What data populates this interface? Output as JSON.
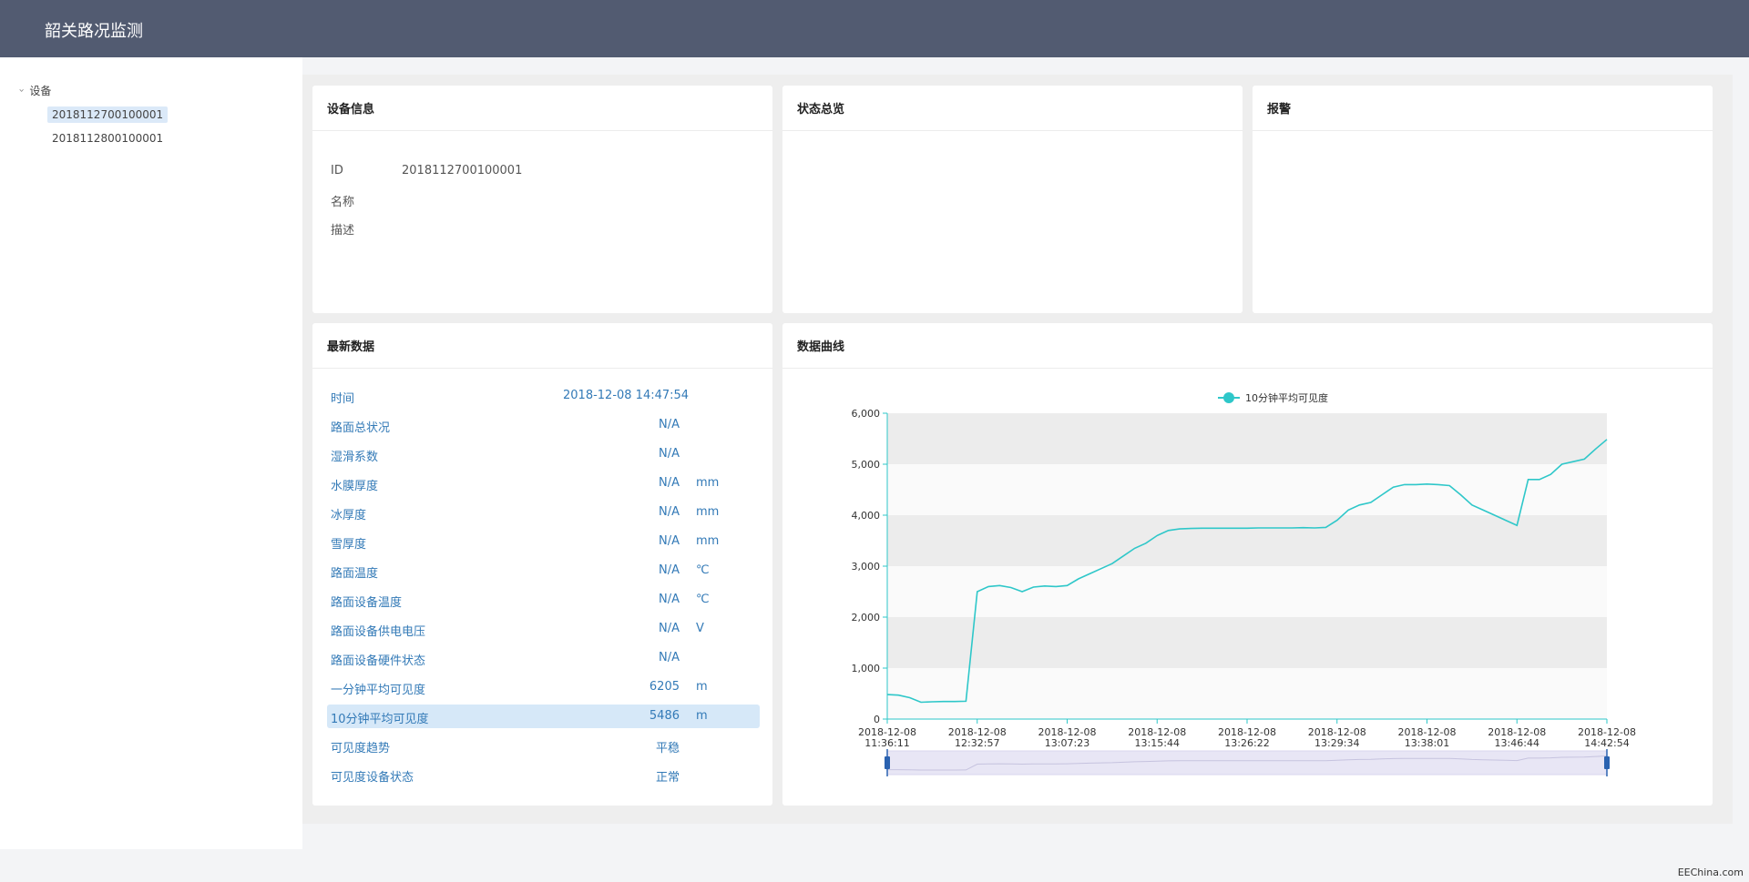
{
  "app": {
    "title": "韶关路况监测"
  },
  "tree": {
    "root": "设备",
    "items": [
      "2018112700100001",
      "2018112800100001"
    ],
    "selected_index": 0
  },
  "device_info": {
    "title": "设备信息",
    "rows": [
      {
        "label": "ID",
        "value": "2018112700100001"
      },
      {
        "label": "名称",
        "value": ""
      },
      {
        "label": "描述",
        "value": ""
      }
    ]
  },
  "status": {
    "title": "状态总览"
  },
  "alarm": {
    "title": "报警"
  },
  "latest": {
    "title": "最新数据",
    "time_label": "时间",
    "time_value": "2018-12-08 14:47:54",
    "rows": [
      {
        "label": "路面总状况",
        "value": "N/A",
        "unit": ""
      },
      {
        "label": "湿滑系数",
        "value": "N/A",
        "unit": ""
      },
      {
        "label": "水膜厚度",
        "value": "N/A",
        "unit": "mm"
      },
      {
        "label": "冰厚度",
        "value": "N/A",
        "unit": "mm"
      },
      {
        "label": "雪厚度",
        "value": "N/A",
        "unit": "mm"
      },
      {
        "label": "路面温度",
        "value": "N/A",
        "unit": "℃"
      },
      {
        "label": "路面设备温度",
        "value": "N/A",
        "unit": "℃"
      },
      {
        "label": "路面设备供电电压",
        "value": "N/A",
        "unit": "V"
      },
      {
        "label": "路面设备硬件状态",
        "value": "N/A",
        "unit": ""
      },
      {
        "label": "一分钟平均可见度",
        "value": "6205",
        "unit": "m"
      },
      {
        "label": "10分钟平均可见度",
        "value": "5486",
        "unit": "m"
      },
      {
        "label": "可见度趋势",
        "value": "平稳",
        "unit": ""
      },
      {
        "label": "可见度设备状态",
        "value": "正常",
        "unit": ""
      }
    ],
    "highlight_index": 10
  },
  "curve": {
    "title": "数据曲线"
  },
  "chart_data": {
    "type": "line",
    "title": "",
    "legend": {
      "entries": [
        "10分钟平均可见度"
      ],
      "placement": "top-center"
    },
    "series": [
      {
        "name": "10分钟平均可见度",
        "color": "#2ec7c9",
        "values": [
          480,
          470,
          420,
          330,
          340,
          345,
          345,
          350,
          2500,
          2600,
          2620,
          2580,
          2500,
          2590,
          2610,
          2600,
          2620,
          2750,
          2850,
          2950,
          3050,
          3200,
          3350,
          3450,
          3600,
          3700,
          3730,
          3740,
          3745,
          3745,
          3745,
          3745,
          3745,
          3750,
          3750,
          3750,
          3750,
          3755,
          3750,
          3760,
          3900,
          4100,
          4200,
          4250,
          4400,
          4550,
          4600,
          4600,
          4610,
          4600,
          4580,
          4400,
          4200,
          4100,
          4000,
          3900,
          3800,
          4700,
          4700,
          4800,
          5000,
          5050,
          5100,
          5300,
          5486
        ]
      }
    ],
    "xticks": [
      [
        "2018-12-08",
        "11:36:11"
      ],
      [
        "2018-12-08",
        "12:32:57"
      ],
      [
        "2018-12-08",
        "13:07:23"
      ],
      [
        "2018-12-08",
        "13:15:44"
      ],
      [
        "2018-12-08",
        "13:26:22"
      ],
      [
        "2018-12-08",
        "13:29:34"
      ],
      [
        "2018-12-08",
        "13:38:01"
      ],
      [
        "2018-12-08",
        "13:46:44"
      ],
      [
        "2018-12-08",
        "14:42:54"
      ]
    ],
    "yticks": [
      "0",
      "1,000",
      "2,000",
      "3,000",
      "4,000",
      "5,000",
      "6,000"
    ],
    "ylim": [
      0,
      6000
    ],
    "grid": "alternating-bands",
    "datazoom": {
      "start": 0,
      "end": 1
    },
    "colors": {
      "line": "#2ec7c9",
      "axis": "#2ec7c9",
      "band": "#ececec",
      "zoom_fill": "#e8e6f5",
      "zoom_handle": "#2a62b0"
    }
  },
  "footer": {
    "text": "EEChina.com"
  }
}
